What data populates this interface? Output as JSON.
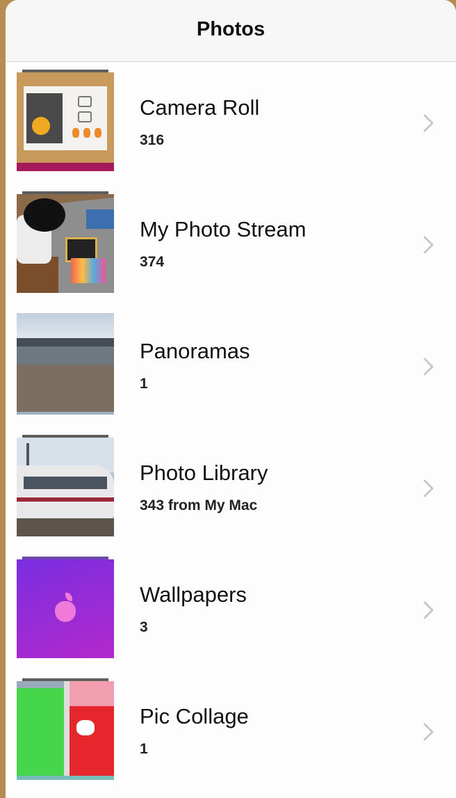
{
  "navbar": {
    "title": "Photos"
  },
  "albums": [
    {
      "title": "Camera Roll",
      "subtitle": "316"
    },
    {
      "title": "My Photo Stream",
      "subtitle": "374"
    },
    {
      "title": "Panoramas",
      "subtitle": "1"
    },
    {
      "title": "Photo Library",
      "subtitle": "343 from My Mac"
    },
    {
      "title": "Wallpapers",
      "subtitle": "3"
    },
    {
      "title": "Pic Collage",
      "subtitle": "1"
    }
  ],
  "icons": {
    "disclosure": "chevron-right-icon"
  },
  "colors": {
    "background": "#b58d52",
    "panel": "#fdfdfd",
    "navbar": "#f7f7f7",
    "chevron": "#c7c7cc"
  }
}
